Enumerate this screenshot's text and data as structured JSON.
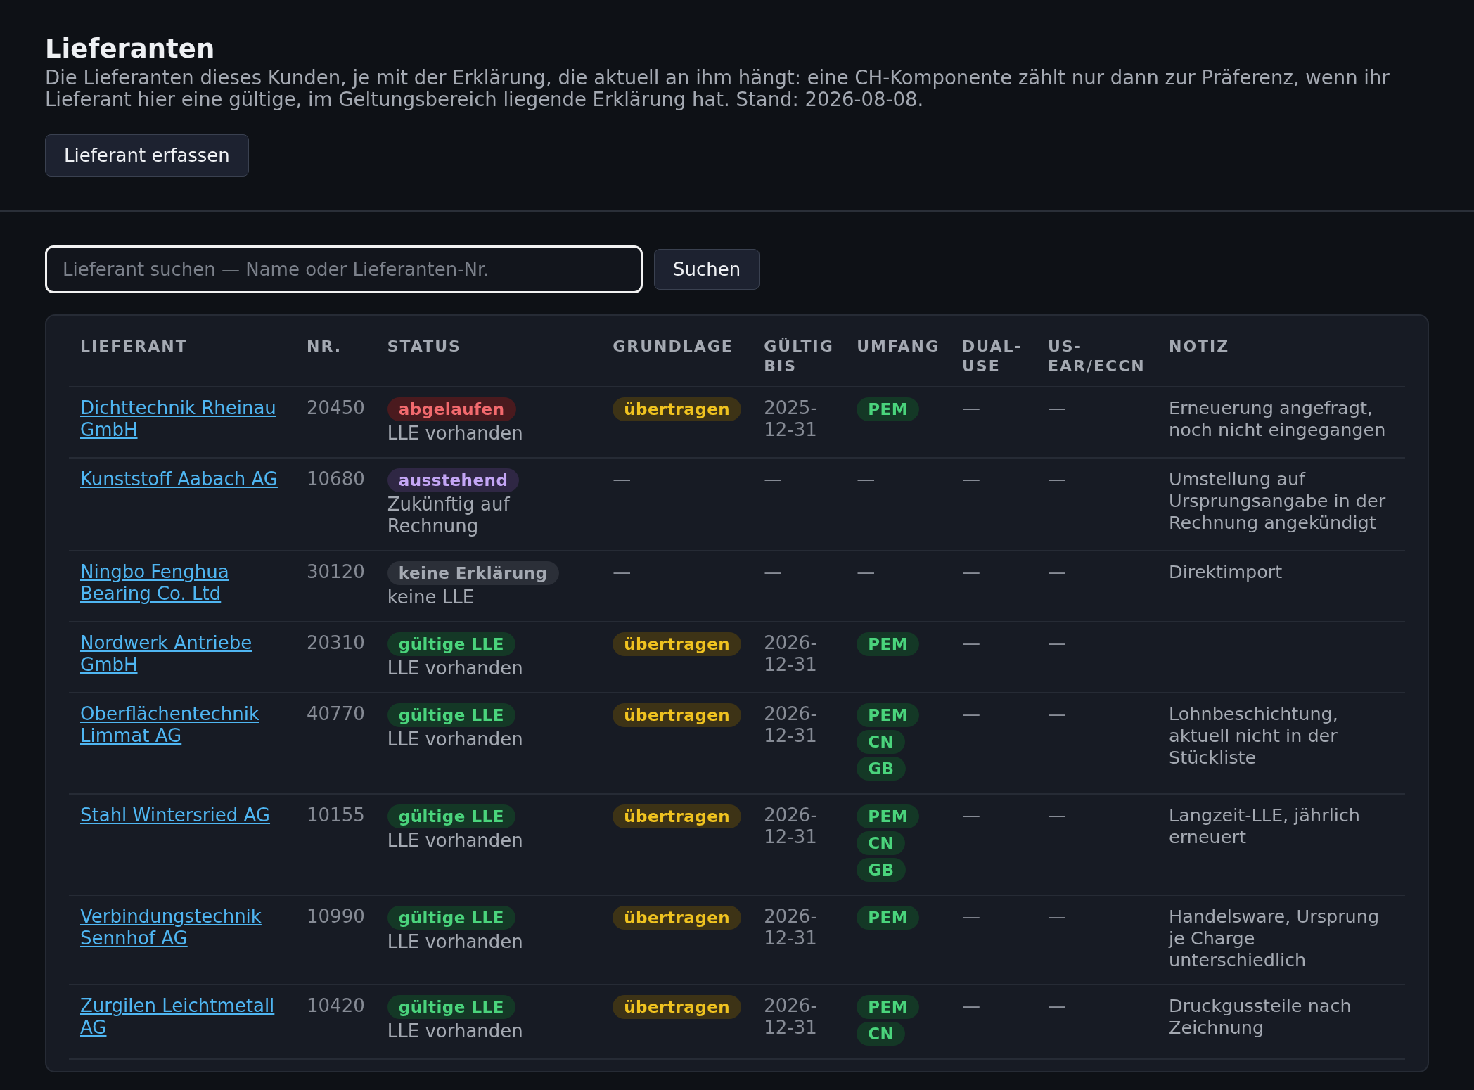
{
  "page": {
    "title": "Lieferanten",
    "description": "Die Lieferanten dieses Kunden, je mit der Erklärung, die aktuell an ihm hängt: eine CH-Komponente zählt nur dann zur Präferenz, wenn ihr Lieferant hier eine gültige, im Geltungsbereich liegende Erklärung hat. Stand: 2026-08-08.",
    "add_button": "Lieferant erfassen"
  },
  "search": {
    "placeholder": "Lieferant suchen — Name oder Lieferanten-Nr.",
    "button": "Suchen",
    "focused": true
  },
  "table": {
    "columns": [
      "LIEFERANT",
      "NR.",
      "STATUS",
      "GRUNDLAGE",
      "GÜLTIG BIS",
      "UMFANG",
      "DUAL-USE",
      "US-EAR/ECCN",
      "NOTIZ"
    ],
    "rows": [
      {
        "supplier": "Dichttechnik Rheinau GmbH",
        "number": "20450",
        "status": {
          "label": "abgelaufen",
          "kind": "expired",
          "detail": "LLE vorhanden"
        },
        "basis": {
          "kind": "badge",
          "text": "übertragen"
        },
        "valid_until": "2025-12-31",
        "scope": [
          "PEM"
        ],
        "dual_use": "—",
        "us_ear_eccn": "—",
        "note": "Erneuerung angefragt, noch nicht eingegangen"
      },
      {
        "supplier": "Kunststoff Aabach AG",
        "number": "10680",
        "status": {
          "label": "ausstehend",
          "kind": "pending",
          "detail": "Zukünftig auf Rechnung"
        },
        "basis": {
          "kind": "text",
          "text": "—"
        },
        "valid_until": "—",
        "scope": "—",
        "dual_use": "—",
        "us_ear_eccn": "—",
        "note": "Umstellung auf Ursprungsangabe in der Rechnung angekündigt"
      },
      {
        "supplier": "Ningbo Fenghua Bearing Co. Ltd",
        "number": "30120",
        "status": {
          "label": "keine Erklärung",
          "kind": "none",
          "detail": "keine LLE"
        },
        "basis": {
          "kind": "text",
          "text": "—"
        },
        "valid_until": "—",
        "scope": "—",
        "dual_use": "—",
        "us_ear_eccn": "—",
        "note": "Direktimport"
      },
      {
        "supplier": "Nordwerk Antriebe GmbH",
        "number": "20310",
        "status": {
          "label": "gültige LLE",
          "kind": "valid",
          "detail": "LLE vorhanden"
        },
        "basis": {
          "kind": "badge",
          "text": "übertragen"
        },
        "valid_until": "2026-12-31",
        "scope": [
          "PEM"
        ],
        "dual_use": "—",
        "us_ear_eccn": "—"
      },
      {
        "supplier": "Oberflächentechnik Limmat AG",
        "number": "40770",
        "status": {
          "label": "gültige LLE",
          "kind": "valid",
          "detail": "LLE vorhanden"
        },
        "basis": {
          "kind": "badge",
          "text": "übertragen"
        },
        "valid_until": "2026-12-31",
        "scope": [
          "PEM",
          "CN",
          "GB"
        ],
        "dual_use": "—",
        "us_ear_eccn": "—",
        "note": "Lohnbeschichtung, aktuell nicht in der Stückliste"
      },
      {
        "supplier": "Stahl Wintersried AG",
        "number": "10155",
        "status": {
          "label": "gültige LLE",
          "kind": "valid",
          "detail": "LLE vorhanden"
        },
        "basis": {
          "kind": "badge",
          "text": "übertragen"
        },
        "valid_until": "2026-12-31",
        "scope": [
          "PEM",
          "CN",
          "GB"
        ],
        "dual_use": "—",
        "us_ear_eccn": "—",
        "note": "Langzeit-LLE, jährlich erneuert"
      },
      {
        "supplier": "Verbindungstechnik Sennhof AG",
        "number": "10990",
        "status": {
          "label": "gültige LLE",
          "kind": "valid",
          "detail": "LLE vorhanden"
        },
        "basis": {
          "kind": "badge",
          "text": "übertragen"
        },
        "valid_until": "2026-12-31",
        "scope": [
          "PEM"
        ],
        "dual_use": "—",
        "us_ear_eccn": "—",
        "note": "Handelsware, Ursprung je Charge unterschiedlich"
      },
      {
        "supplier": "Zurgilen Leichtmetall AG",
        "number": "10420",
        "status": {
          "label": "gültige LLE",
          "kind": "valid",
          "detail": "LLE vorhanden"
        },
        "basis": {
          "kind": "badge",
          "text": "übertragen"
        },
        "valid_until": "2026-12-31",
        "scope": [
          "PEM",
          "CN"
        ],
        "dual_use": "—",
        "us_ear_eccn": "—",
        "note": "Druckgussteile nach Zeichnung"
      }
    ]
  }
}
